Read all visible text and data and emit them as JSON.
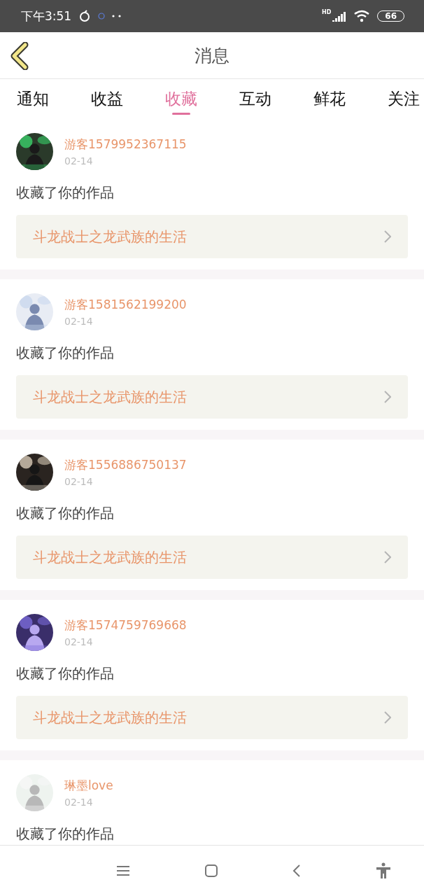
{
  "status_bar": {
    "time": "下午3:51",
    "network": "HD",
    "battery": "66"
  },
  "header": {
    "title": "消息"
  },
  "tabs": [
    {
      "label": "通知",
      "selected": false
    },
    {
      "label": "收益",
      "selected": false
    },
    {
      "label": "收藏",
      "selected": true
    },
    {
      "label": "互动",
      "selected": false
    },
    {
      "label": "鲜花",
      "selected": false
    },
    {
      "label": "关注",
      "selected": false
    }
  ],
  "messages": [
    {
      "user": "游客1579952367115",
      "date": "02-14",
      "text": "收藏了你的作品",
      "work": "斗龙战士之龙武族的生活"
    },
    {
      "user": "游客1581562199200",
      "date": "02-14",
      "text": "收藏了你的作品",
      "work": "斗龙战士之龙武族的生活"
    },
    {
      "user": "游客1556886750137",
      "date": "02-14",
      "text": "收藏了你的作品",
      "work": "斗龙战士之龙武族的生活"
    },
    {
      "user": "游客1574759769668",
      "date": "02-14",
      "text": "收藏了你的作品",
      "work": "斗龙战士之龙武族的生活"
    },
    {
      "user": "琳墨love",
      "date": "02-14",
      "text": "收藏了你的作品"
    }
  ]
}
